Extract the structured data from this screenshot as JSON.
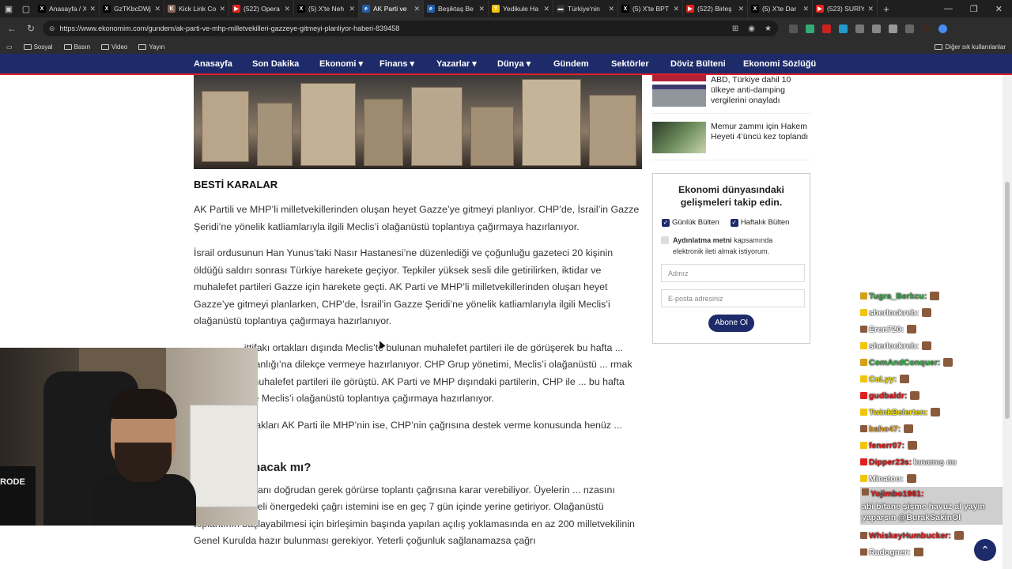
{
  "browser": {
    "tabs": [
      {
        "label": "Anasayfa / X",
        "fav": "X",
        "color": "#000000"
      },
      {
        "label": "GzTKbcDWj",
        "fav": "X",
        "color": "#000000"
      },
      {
        "label": "Kick Link Co",
        "fav": "K",
        "color": "#8a6a5a"
      },
      {
        "label": "(522) Opera",
        "fav": "▶",
        "color": "#e62117"
      },
      {
        "label": "(5) X'te Neh",
        "fav": "X",
        "color": "#000000"
      },
      {
        "label": "AK Parti ve",
        "fav": "e",
        "color": "#1d5fa8"
      },
      {
        "label": "Beşiktaş Be",
        "fav": "e",
        "color": "#1d5fa8"
      },
      {
        "label": "Yedikule Ha",
        "fav": "Y",
        "color": "#f4c20d"
      },
      {
        "label": "Türkiye'nin",
        "fav": "▬",
        "color": "#333333"
      },
      {
        "label": "(5) X'te BPT",
        "fav": "X",
        "color": "#000000"
      },
      {
        "label": "(522) Birleş",
        "fav": "▶",
        "color": "#e62117"
      },
      {
        "label": "(5) X'te Dar",
        "fav": "X",
        "color": "#000000"
      },
      {
        "label": "(523) SURİY",
        "fav": "▶",
        "color": "#e62117"
      }
    ],
    "active_tab": 5,
    "url": "https://www.ekonomim.com/gundem/ak-parti-ve-mhp-milletvekilleri-gazzeye-gitmeyi-planliyor-haberi-839458",
    "bookmarks": [
      "Sosyal",
      "Basın",
      "Video",
      "Yayın"
    ],
    "other_bookmarks": "Diğer sık kullanılanlar"
  },
  "site_nav": {
    "items": [
      "Anasayfa",
      "Son Dakika",
      "Ekonomi ▾",
      "Finans ▾",
      "Yazarlar ▾",
      "Dünya ▾",
      "Gündem",
      "Sektörler",
      "Döviz Bülteni",
      "Ekonomi Sözlüğü"
    ]
  },
  "article": {
    "subheading": "BESTİ KARALAR",
    "p1": "AK Partili ve MHP’li milletvekillerinden oluşan heyet Gazze’ye gitmeyi planlıyor. CHP’de, İsrail’in Gazze Şeridi’ne yönelik katliamlarıyla ilgili Meclis’i olağanüstü toplantıya çağırmaya hazırlanıyor.",
    "p2": "İsrail ordusunun Han Yunus’taki Nasır Hastanesi’ne düzenlediği ve çoğunluğu gazeteci 20 kişinin öldüğü saldırı sonrası Türkiye harekete geçiyor. Tepkiler yüksek sesli dile getirilirken, iktidar ve muhalefet partileri Gazze için harekete geçti. AK Parti ve MHP’li milletvekillerinden oluşan heyet Gazze’ye gitmeyi planlarken, CHP’de, İsrail’in Gazze Şeridi’ne yönelik katliamlarıyla ilgili Meclis’i olağanüstü toplantıya çağırmaya hazırlanıyor.",
    "p3": "... ittifakı ortakları dışında Meclis’te bulunan muhalefet partileri ile de görüşerek bu hafta ... Başkanlığı’na dilekçe vermeye hazırlanıyor. CHP Grup yönetimi, Meclis’i olağanüstü ... rmak için muhalefet partileri ile görüştü. AK Parti ve MHP dışındaki partilerin, CHP ile ... bu hafta içinde Meclis’i olağanüstü toplantıya çağırmaya hazırlanıyor.",
    "p4": "... ortakları AK Parti ile MHP’nin ise, CHP’nin çağrısına destek verme konusunda henüz ... değil.",
    "heading": "... anacak mı?",
    "p5": "... TBMM Başkanı doğrudan gerek görürse toplantı çağrısına karar verebiliyor. Üyelerin ... nzasını taşıyan gerekçeli önergedeki çağrı istemini ise en geç 7 gün içinde yerine getiriyor. Olağanüstü toplantının başlayabilmesi için birleşimin başında yapılan açılış yoklamasında en az 200 milletvekilinin Genel Kurulda hazır bulunması gerekiyor. Yeterli çoğunluk sağlanamazsa çağrı"
  },
  "sidebar": {
    "news": [
      {
        "title": "ABD, Türkiye dahil 10 ülkeye anti-damping vergilerini onayladı"
      },
      {
        "title": "Memur zammı için Hakem Heyeti 4’üncü kez toplandı"
      }
    ],
    "newsletter": {
      "title": "Ekonomi dünyasındaki gelişmeleri takip edin.",
      "daily": "Günlük Bülten",
      "weekly": "Haftalık Bülten",
      "consent_bold": "Aydınlatma metni",
      "consent_rest": " kapsamında elektronik ileti almak istiyorum.",
      "name_placeholder": "Adınız",
      "email_placeholder": "E-posta adresiniz",
      "submit": "Abone Ol"
    }
  },
  "webcam": {
    "mic_label": "RODE"
  },
  "chat": [
    {
      "user": "Tugra_Berkcu:",
      "color": "#3fae49",
      "msg": "",
      "badge": "#d4a017"
    },
    {
      "user": "sherlockreb:",
      "color": "#ffffff",
      "msg": "",
      "badge": "#f2c40a"
    },
    {
      "user": "Eren720:",
      "color": "#ffffff",
      "msg": "",
      "badge": ""
    },
    {
      "user": "sherlockreb:",
      "color": "#ffffff",
      "msg": "",
      "badge": "#f2c40a"
    },
    {
      "user": "ComAndConquer:",
      "color": "#3fae49",
      "msg": "",
      "badge": "#d4a017"
    },
    {
      "user": "CuLyy:",
      "color": "#f2e10a",
      "msg": "",
      "badge": "#f2c40a"
    },
    {
      "user": "gudbaldr:",
      "color": "#e02020",
      "msg": "",
      "badge": "#e02020"
    },
    {
      "user": "TwinkBelerten:",
      "color": "#f2e10a",
      "msg": "",
      "badge": "#f2c40a"
    },
    {
      "user": "baho47:",
      "color": "#e8a030",
      "msg": "",
      "badge": ""
    },
    {
      "user": "fenerr07:",
      "color": "#e02020",
      "msg": "",
      "badge": "#f2c40a"
    },
    {
      "user": "Dipper23s:",
      "color": "#e02020",
      "msg": "kınamış mı",
      "badge": "#e02020"
    },
    {
      "user": "Minatoo:",
      "color": "#ffffff",
      "msg": "",
      "badge": "#f2c40a"
    }
  ],
  "chat_highlight": {
    "user": "Yojimbo1961:",
    "color": "#e02020",
    "msg": "abi bitane şişme havuz al yayın yaparsın @BurakSakinOl"
  },
  "chat_tail": [
    {
      "user": "WhiskeyHumbucker:",
      "color": "#e02020",
      "msg": ""
    },
    {
      "user": "Radogner:",
      "color": "#ffffff",
      "msg": ""
    }
  ]
}
